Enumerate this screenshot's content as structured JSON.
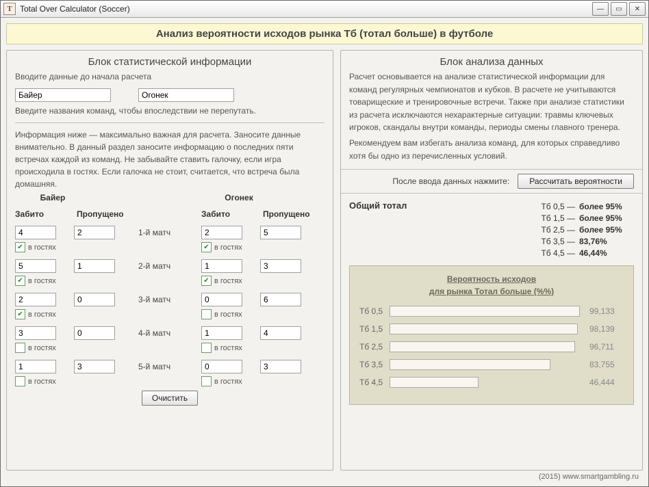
{
  "window": {
    "title": "Total Over Calculator (Soccer)"
  },
  "banner": "Анализ вероятности исходов рынка Тб (тотал больше) в футболе",
  "left": {
    "title": "Блок статистической информации",
    "intro": "Вводите данные до начала расчета",
    "team1": "Байер",
    "team2": "Огонек",
    "hint": "Введите названия команд, чтобы впоследствии не перепутать.",
    "desc": "Информация ниже — максимально важная для расчета. Заносите данные внимательно. В данный раздел заносите информацию о последних пяти встречах каждой из команд. Не забывайте ставить галочку, если игра происходила в гостях. Если галочка не стоит, считается, что встреча была домашняя.",
    "colScored": "Забито",
    "colMissed": "Пропущено",
    "awayLabel": "в гостях",
    "matchLabels": [
      "1-й матч",
      "2-й матч",
      "3-й матч",
      "4-й матч",
      "5-й матч"
    ],
    "matches": [
      {
        "t1s": "4",
        "t1m": "2",
        "t1a": true,
        "t2s": "2",
        "t2m": "5",
        "t2a": true
      },
      {
        "t1s": "5",
        "t1m": "1",
        "t1a": true,
        "t2s": "1",
        "t2m": "3",
        "t2a": true
      },
      {
        "t1s": "2",
        "t1m": "0",
        "t1a": true,
        "t2s": "0",
        "t2m": "6",
        "t2a": false
      },
      {
        "t1s": "3",
        "t1m": "0",
        "t1a": false,
        "t2s": "1",
        "t2m": "4",
        "t2a": false
      },
      {
        "t1s": "1",
        "t1m": "3",
        "t1a": false,
        "t2s": "0",
        "t2m": "3",
        "t2a": false
      }
    ],
    "clear": "Очистить"
  },
  "right": {
    "title": "Блок анализа данных",
    "p1": "Расчет основывается на анализе статистической информации для команд регулярных чемпионатов и кубков. В расчете не учитываются товарищеские и тренировочные встречи. Также при анализе статистики из расчета исключаются нехарактерные ситуации: травмы ключевых игроков, скандалы внутри команды, периоды смены главного тренера.",
    "p2": "Рекомендуем вам избегать анализа команд, для которых справедливо хотя бы одно из перечисленных условий.",
    "calcLabel": "После ввода данных нажмите:",
    "calcBtn": "Рассчитать вероятности",
    "totalLabel": "Общий тотал",
    "totals": [
      {
        "k": "Тб 0,5 —",
        "v": "более 95%"
      },
      {
        "k": "Тб 1,5 —",
        "v": "более 95%"
      },
      {
        "k": "Тб 2,5 —",
        "v": "более 95%"
      },
      {
        "k": "Тб 3,5 —",
        "v": "83,76%"
      },
      {
        "k": "Тб 4,5 —",
        "v": "46,44%"
      }
    ],
    "chartTitle1": "Вероятность исходов",
    "chartTitle2": "для рынка Тотал больше (%%)"
  },
  "chart_data": {
    "type": "bar",
    "title": "Вероятность исходов для рынка Тотал больше (%)",
    "xlabel": "",
    "ylabel": "",
    "ylim": [
      0,
      100
    ],
    "categories": [
      "Тб 0,5",
      "Тб 1,5",
      "Тб 2,5",
      "Тб 3,5",
      "Тб 4,5"
    ],
    "values": [
      99.133,
      98.139,
      96.711,
      83.755,
      46.444
    ],
    "value_labels": [
      "99,133",
      "98,139",
      "96,711",
      "83,755",
      "46,444"
    ]
  },
  "footer": "(2015) www.smartgambling.ru"
}
